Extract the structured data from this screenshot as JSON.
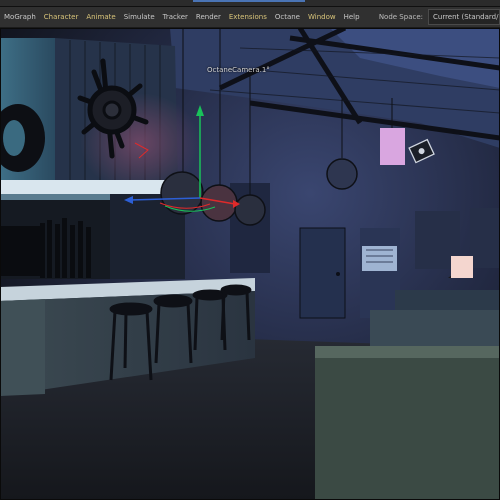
{
  "menubar": {
    "items": [
      {
        "label": "MoGraph"
      },
      {
        "label": "Character"
      },
      {
        "label": "Animate"
      },
      {
        "label": "Simulate"
      },
      {
        "label": "Tracker"
      },
      {
        "label": "Render"
      },
      {
        "label": "Extensions"
      },
      {
        "label": "Octane"
      },
      {
        "label": "Window"
      },
      {
        "label": "Help"
      }
    ],
    "node_space_label": "Node Space:",
    "node_space_value": "Current (Standard/Phys"
  },
  "viewport": {
    "camera_label": "OctaneCamera.1",
    "camera_marker": "°"
  }
}
